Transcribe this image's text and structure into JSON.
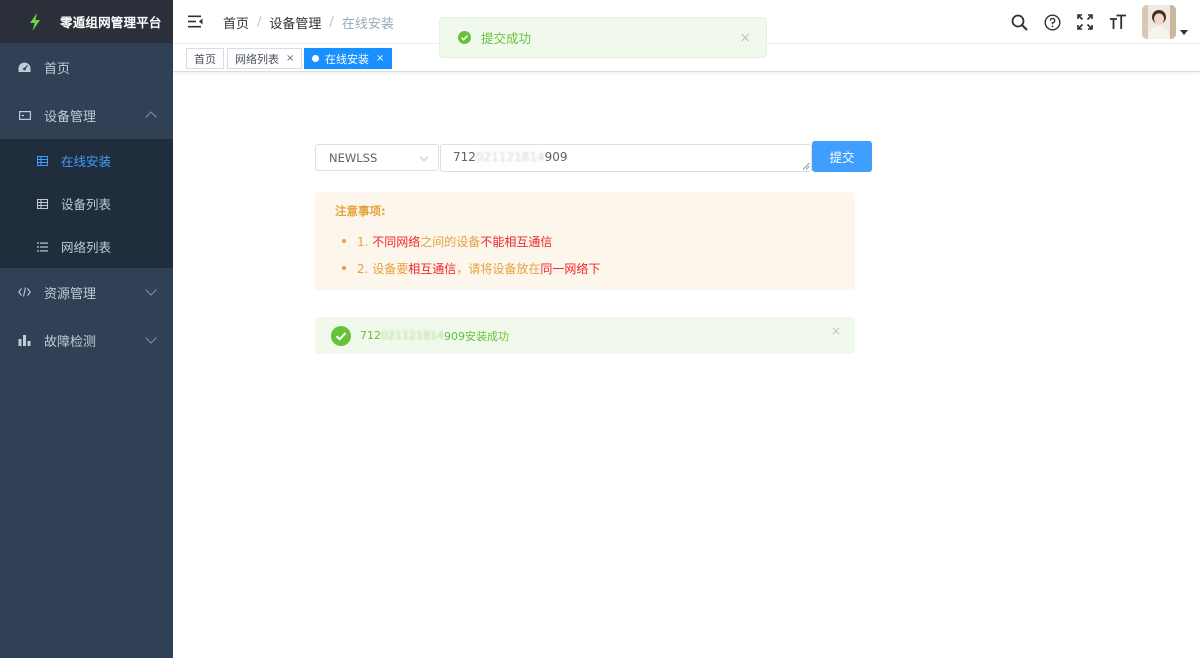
{
  "app": {
    "title": "零遁组网管理平台"
  },
  "sidebar": {
    "items": [
      {
        "label": "首页",
        "icon": "dashboard-icon"
      },
      {
        "label": "设备管理",
        "icon": "device-icon",
        "expanded": true,
        "children": [
          {
            "label": "在线安装",
            "icon": "table-icon",
            "active": true
          },
          {
            "label": "设备列表",
            "icon": "table-icon"
          },
          {
            "label": "网络列表",
            "icon": "list-icon"
          }
        ]
      },
      {
        "label": "资源管理",
        "icon": "code-icon"
      },
      {
        "label": "故障检测",
        "icon": "chart-icon"
      }
    ]
  },
  "breadcrumb": {
    "items": [
      "首页",
      "设备管理",
      "在线安装"
    ],
    "separator": "/"
  },
  "header": {
    "right_icons": [
      "search-icon",
      "help-icon",
      "fullscreen-icon",
      "font-size-icon"
    ]
  },
  "tags": [
    {
      "label": "首页",
      "active": false
    },
    {
      "label": "网络列表",
      "active": false,
      "close": "×"
    },
    {
      "label": "在线安装",
      "active": true,
      "close": "×"
    }
  ],
  "toast": {
    "text": "提交成功",
    "close": "×"
  },
  "form": {
    "model_value": "NEWLSS",
    "sn_prefix": "712",
    "sn_masked": "021121814",
    "sn_suffix": "909",
    "submit_label": "提交"
  },
  "notice": {
    "title": "注意事项:",
    "item1": {
      "n": "1.",
      "a": "不同网络",
      "b": "之间的设备",
      "c": "不能相互通信"
    },
    "item2": {
      "n": "2.",
      "a": "设备要",
      "b": "相互通信",
      "c": "，请将设备放在",
      "d": "同一网络下"
    }
  },
  "result": {
    "prefix": "712",
    "masked": "021121814",
    "suffix": "909安装成功",
    "close": "×"
  },
  "colors": {
    "sidebar_bg": "#304156",
    "submenu_bg": "#1f2d3d",
    "accent": "#409eff",
    "success": "#67c23a",
    "warning": "#e6a23c",
    "danger": "#f02626"
  }
}
